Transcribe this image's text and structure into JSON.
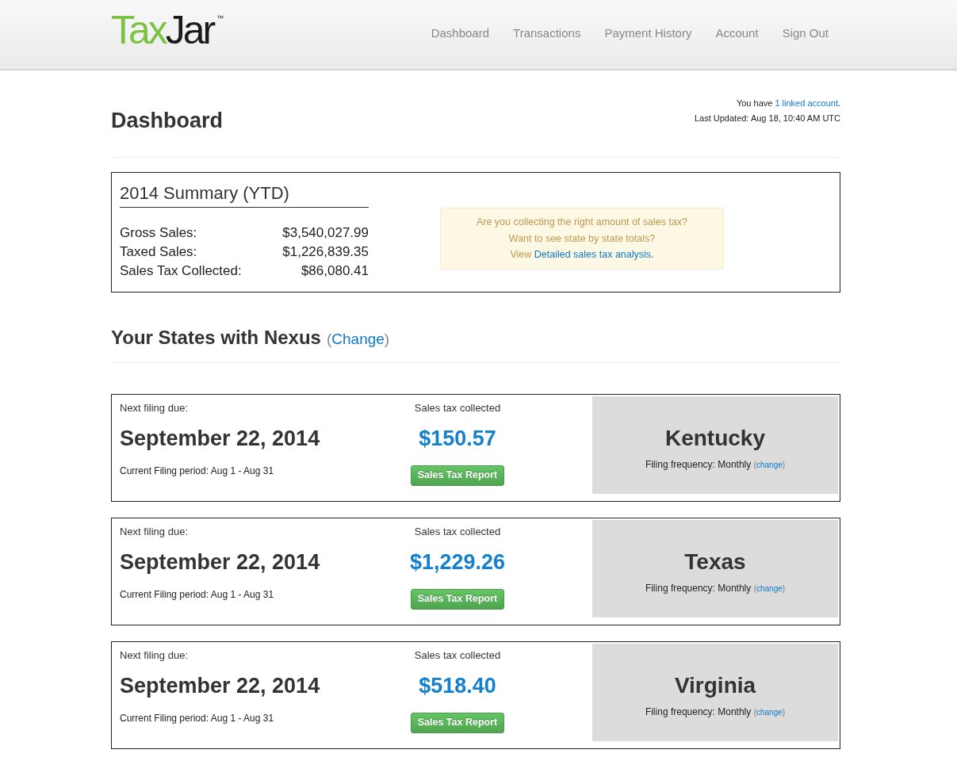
{
  "header": {
    "logo": {
      "parts": [
        {
          "text": "Tax",
          "color": "#7dc142"
        },
        {
          "text": "Jar",
          "color": "#1b1b1b"
        }
      ],
      "trademark": "™"
    },
    "nav": [
      "Dashboard",
      "Transactions",
      "Payment History",
      "Account",
      "Sign Out"
    ]
  },
  "page": {
    "title": "Dashboard",
    "linked_note": {
      "prefix": "You have",
      "link": "1 linked account",
      "suffix": "."
    },
    "last_updated": "Last Updated: Aug 18, 10:40 AM UTC"
  },
  "summary": {
    "title": "2014 Summary (YTD)",
    "rows": [
      {
        "label": "Gross Sales:",
        "value": "$3,540,027.99"
      },
      {
        "label": "Taxed Sales:",
        "value": "$1,226,839.35"
      },
      {
        "label": "Sales Tax Collected:",
        "value": "$86,080.41"
      }
    ],
    "notice": {
      "lines": [
        "Are you collecting the right amount of sales tax?",
        "Want to see state by state totals?"
      ],
      "link_prefix": "View",
      "link": "Detailed sales tax analysis."
    }
  },
  "nexus": {
    "title": "Your States with Nexus",
    "change": {
      "before": "(",
      "link": "Change",
      "after": ")"
    },
    "states": [
      {
        "due_label": "Next filing due:",
        "due_date": "September 22, 2014",
        "period": "Current Filing period: Aug 1 - Aug 31",
        "collected_label": "Sales tax collected",
        "collected": "$150.57",
        "report_button": "Sales Tax Report",
        "state": "Kentucky",
        "frequency": "Filing frequency: Monthly",
        "frequency_change": {
          "before": "(",
          "link": "change",
          "after": ")"
        }
      },
      {
        "due_label": "Next filing due:",
        "due_date": "September 22, 2014",
        "period": "Current Filing period: Aug 1 - Aug 31",
        "collected_label": "Sales tax collected",
        "collected": "$1,229.26",
        "report_button": "Sales Tax Report",
        "state": "Texas",
        "frequency": "Filing frequency: Monthly",
        "frequency_change": {
          "before": "(",
          "link": "change",
          "after": ")"
        }
      },
      {
        "due_label": "Next filing due:",
        "due_date": "September 22, 2014",
        "period": "Current Filing period: Aug 1 - Aug 31",
        "collected_label": "Sales tax collected",
        "collected": "$518.40",
        "report_button": "Sales Tax Report",
        "state": "Virginia",
        "frequency": "Filing frequency: Monthly",
        "frequency_change": {
          "before": "(",
          "link": "change",
          "after": ")"
        }
      }
    ]
  }
}
